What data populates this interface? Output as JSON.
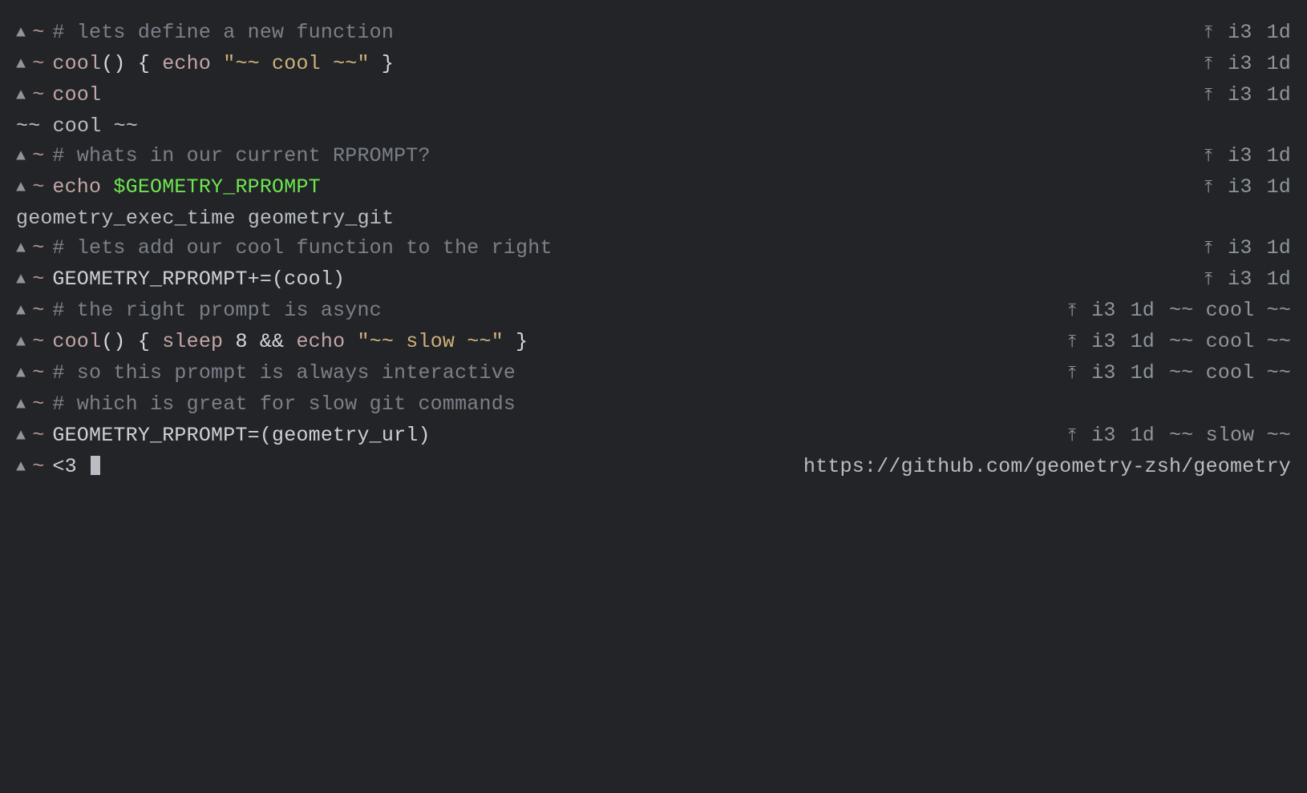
{
  "prompt": {
    "triangle": "▲",
    "tilde": "~"
  },
  "rprompt_arrow": "⤒",
  "rprompt_branch": "i3",
  "rprompt_time": "1d",
  "lines": [
    {
      "type": "p",
      "segs": [
        {
          "c": "comment",
          "t": "# lets define a new function"
        }
      ],
      "r": "std"
    },
    {
      "type": "p",
      "segs": [
        {
          "c": "cmd",
          "t": "cool"
        },
        {
          "c": "sym",
          "t": "() { "
        },
        {
          "c": "kw",
          "t": "echo"
        },
        {
          "c": "sym",
          "t": " "
        },
        {
          "c": "dstr",
          "t": "\"~~ cool ~~\""
        },
        {
          "c": "sym",
          "t": " }"
        }
      ],
      "r": "std"
    },
    {
      "type": "p",
      "segs": [
        {
          "c": "cmd",
          "t": "cool"
        }
      ],
      "r": "std"
    },
    {
      "type": "o",
      "segs": [
        {
          "c": "out",
          "t": "~~ cool ~~"
        }
      ]
    },
    {
      "type": "p",
      "segs": [
        {
          "c": "comment",
          "t": "# whats in our current RPROMPT?"
        }
      ],
      "r": "std"
    },
    {
      "type": "p",
      "segs": [
        {
          "c": "cmd",
          "t": "echo"
        },
        {
          "c": "sym",
          "t": " "
        },
        {
          "c": "var",
          "t": "$GEOMETRY_RPROMPT"
        }
      ],
      "r": "std"
    },
    {
      "type": "o",
      "segs": [
        {
          "c": "out",
          "t": "geometry_exec_time geometry_git"
        }
      ]
    },
    {
      "type": "p",
      "segs": [
        {
          "c": "comment",
          "t": "# lets add our cool function to the right"
        }
      ],
      "r": "std"
    },
    {
      "type": "p",
      "segs": [
        {
          "c": "plain",
          "t": "GEOMETRY_RPROMPT+=(cool)"
        }
      ],
      "r": "std"
    },
    {
      "type": "p",
      "segs": [
        {
          "c": "comment",
          "t": "# the right prompt is async"
        }
      ],
      "r": "cool"
    },
    {
      "type": "p",
      "segs": [
        {
          "c": "cmd",
          "t": "cool"
        },
        {
          "c": "sym",
          "t": "() { "
        },
        {
          "c": "kw",
          "t": "sleep"
        },
        {
          "c": "sym",
          "t": " "
        },
        {
          "c": "num",
          "t": "8"
        },
        {
          "c": "sym",
          "t": " && "
        },
        {
          "c": "kw",
          "t": "echo"
        },
        {
          "c": "sym",
          "t": " "
        },
        {
          "c": "dstr",
          "t": "\"~~ slow ~~\""
        },
        {
          "c": "sym",
          "t": " }"
        }
      ],
      "r": "cool"
    },
    {
      "type": "p",
      "segs": [
        {
          "c": "comment",
          "t": "# so this prompt is always interactive"
        }
      ],
      "r": "cool"
    },
    {
      "type": "p",
      "segs": [
        {
          "c": "comment",
          "t": "# which is great for slow git commands"
        }
      ],
      "r": "none"
    },
    {
      "type": "p",
      "segs": [
        {
          "c": "plain",
          "t": "GEOMETRY_RPROMPT=(geometry_url)"
        }
      ],
      "r": "slow"
    },
    {
      "type": "p",
      "segs": [
        {
          "c": "plain",
          "t": "<3 "
        }
      ],
      "r": "url",
      "cursor": true
    }
  ],
  "cool_suffix": "~~ cool ~~",
  "slow_suffix": "~~ slow ~~",
  "url": "https://github.com/geometry-zsh/geometry"
}
